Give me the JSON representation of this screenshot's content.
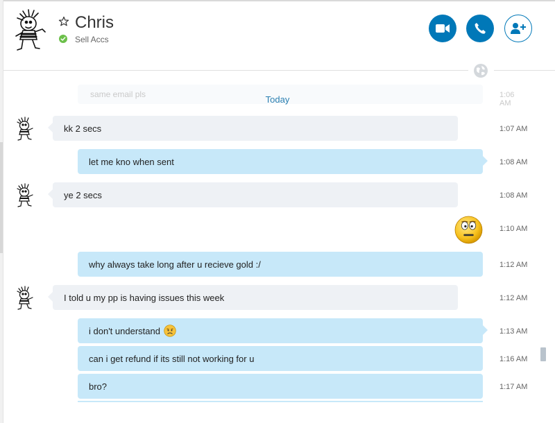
{
  "contact": {
    "name": "Chris",
    "mood": "Sell Accs",
    "presence_color": "#6cc04a"
  },
  "header_buttons": {
    "video_call": "video-icon",
    "voice_call": "phone-icon",
    "add_people": "add-person-icon",
    "accent": "#0078b8"
  },
  "faded_message": {
    "text": "same email pls",
    "time": "1:06 AM"
  },
  "day_separator": "Today",
  "messages": [
    {
      "from": "them",
      "text": "kk 2 secs",
      "time": "1:07 AM"
    },
    {
      "from": "me",
      "text": "let me kno when sent",
      "time": "1:08 AM"
    },
    {
      "from": "them",
      "text": "ye 2 secs",
      "time": "1:08 AM"
    },
    {
      "from": "me",
      "text": "",
      "emoticon": "confused-face",
      "time": "1:10 AM"
    },
    {
      "from": "me",
      "text": "why always take long after u recieve gold :/",
      "time": "1:12 AM"
    },
    {
      "from": "them",
      "text": "I told u my pp is having issues this week",
      "time": "1:12 AM"
    },
    {
      "from": "me",
      "text": "i don't understand",
      "emoticon": "worried-face",
      "time": "1:13 AM"
    },
    {
      "from": "me",
      "text": "can i get refund if its still not working for u",
      "time": "1:16 AM"
    },
    {
      "from": "me",
      "text": "bro?",
      "time": "1:17 AM"
    }
  ]
}
